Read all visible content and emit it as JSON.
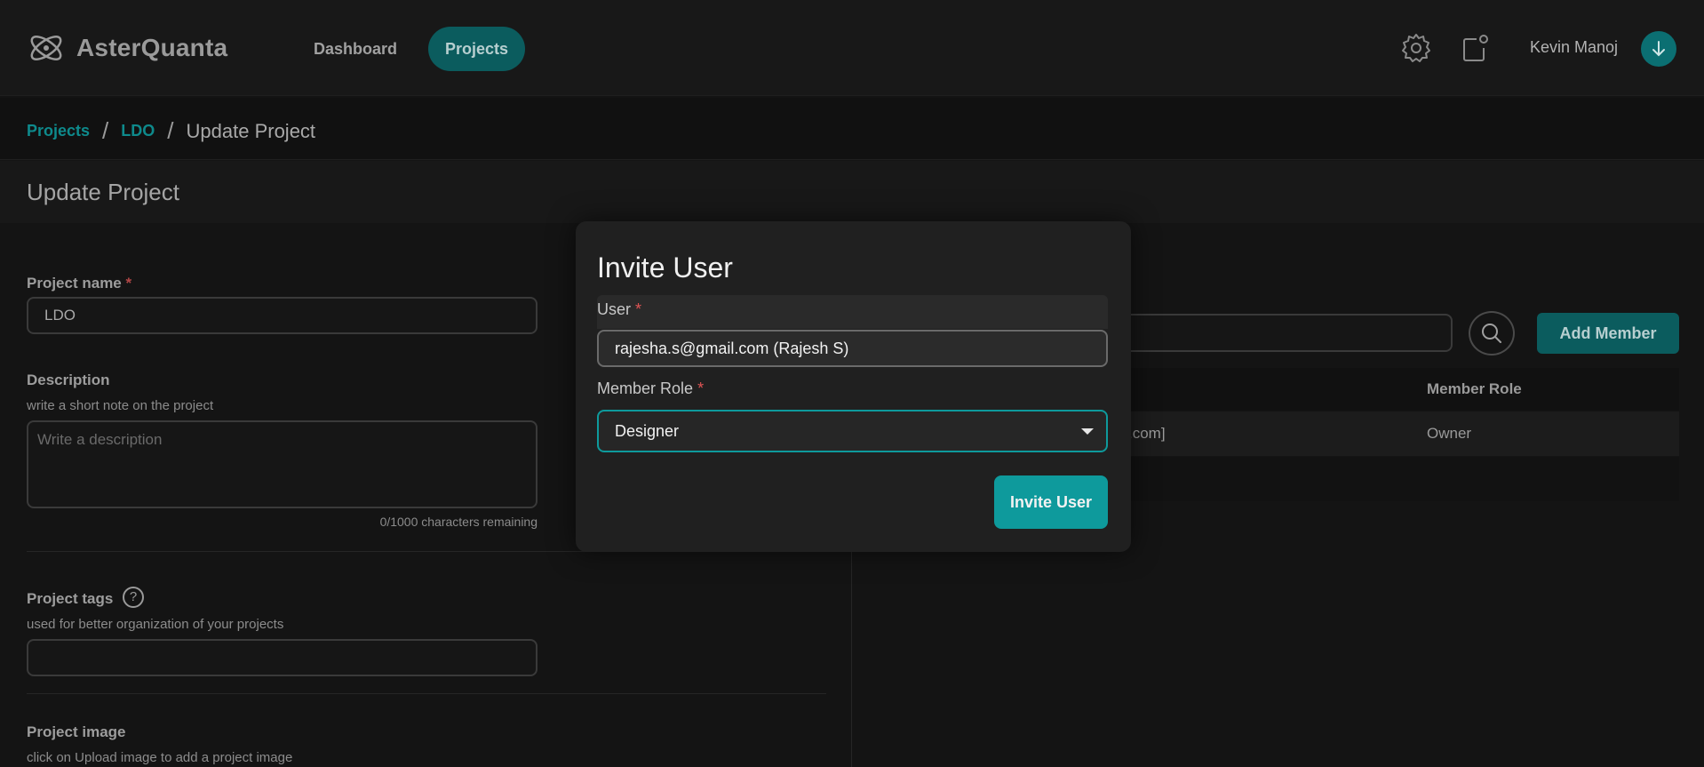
{
  "header": {
    "brand": "AsterQuanta",
    "nav": {
      "dashboard": "Dashboard",
      "projects": "Projects"
    },
    "user_name": "Kevin Manoj",
    "icons": {
      "settings": "gear-icon",
      "notifications": "notification-icon",
      "avatar": "arrow-down-icon"
    }
  },
  "breadcrumb": {
    "root": "Projects",
    "project": "LDO",
    "current": "Update Project",
    "separator": "/"
  },
  "page": {
    "title": "Update Project"
  },
  "form": {
    "project_name": {
      "label": "Project name",
      "required": "*",
      "value": "LDO"
    },
    "description": {
      "label": "Description",
      "hint": "write a short note on the project",
      "placeholder": "Write a description",
      "counter": "0/1000 characters remaining"
    },
    "tags": {
      "label": "Project tags",
      "help": "?",
      "hint": "used for better organization of your projects"
    },
    "image": {
      "label": "Project image",
      "hint": "click on Upload image to add a project image"
    }
  },
  "members": {
    "add_button": "Add Member",
    "columns": {
      "role": "Member Role"
    },
    "rows": [
      {
        "user_fragment": ".com]",
        "role": "Owner"
      }
    ]
  },
  "modal": {
    "title": "Invite User",
    "user_label": "User",
    "required": "*",
    "user_value": "rajesha.s@gmail.com (Rajesh S)",
    "role_label": "Member Role",
    "role_value": "Designer",
    "submit": "Invite User"
  },
  "colors": {
    "accent": "#0e9a9c",
    "accent_dark": "#0b5c5e",
    "required": "#e05454",
    "background": "#141414"
  }
}
